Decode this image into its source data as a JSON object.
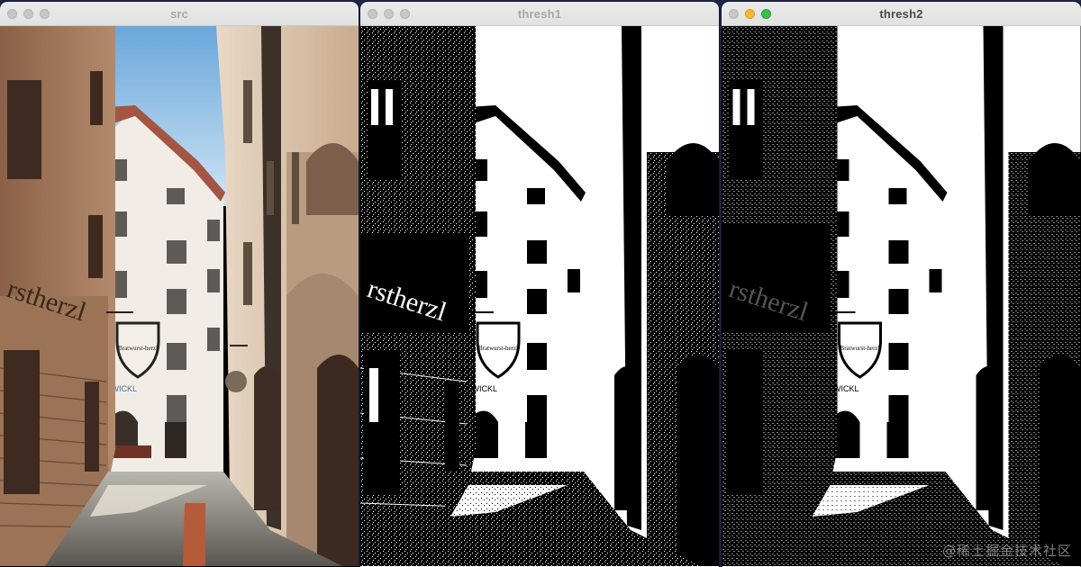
{
  "windows": [
    {
      "title": "src"
    },
    {
      "title": "thresh1"
    },
    {
      "title": "thresh2"
    }
  ],
  "signs": {
    "shop": "Bratwurst-herzl",
    "facade": "rstherzl",
    "zwickl": "ZWICKL"
  },
  "watermark": "@稀土掘金技术社区"
}
